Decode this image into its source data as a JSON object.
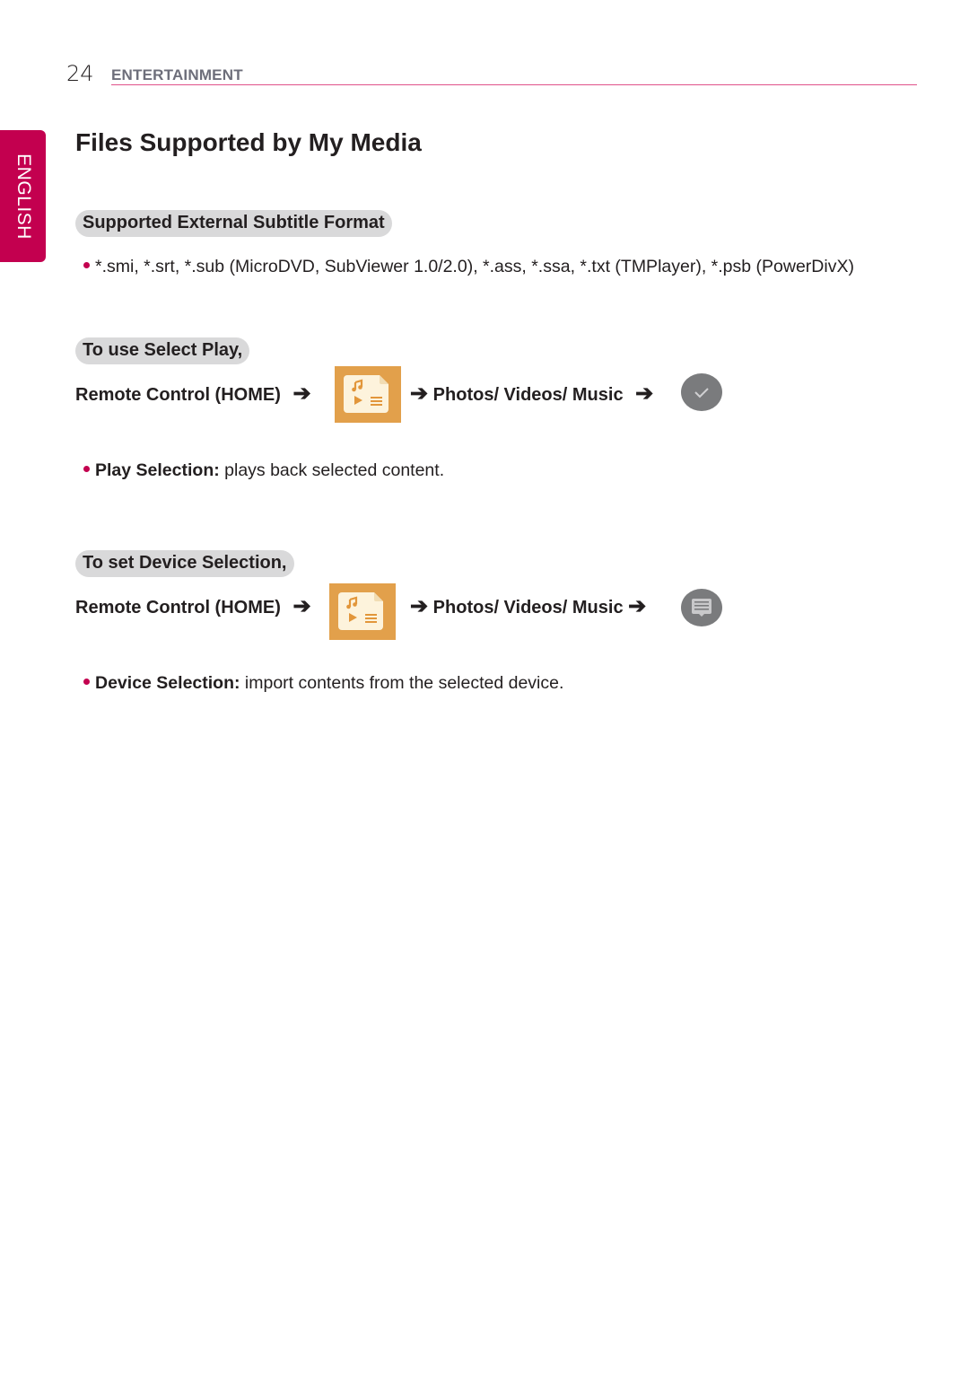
{
  "header": {
    "page_number": "24",
    "section": "ENTERTAINMENT",
    "accent_color": "#c3004f"
  },
  "language_tab": {
    "label": "ENGLISH"
  },
  "title": "Files Supported by My Media",
  "subtitle_section": {
    "heading": "Supported External Subtitle Format",
    "bullet": "*.smi, *.srt, *.sub (MicroDVD, SubViewer 1.0/2.0), *.ass, *.ssa, *.txt (TMPlayer), *.psb (PowerDivX)"
  },
  "select_play": {
    "heading": "To use Select Play,",
    "step1": "Remote Control (HOME)",
    "arrow": "➔",
    "app_icon": "my-media-icon",
    "step2": "Photos/ Videos/ Music",
    "final_icon": "checkmark-icon",
    "bullet_term": "Play Selection:",
    "bullet_desc": " plays back selected content."
  },
  "device_selection": {
    "heading": "To set Device Selection,",
    "step1": "Remote Control (HOME)",
    "arrow": "➔",
    "app_icon": "my-media-icon",
    "step2": "Photos/ Videos/ Music",
    "final_icon": "device-list-icon",
    "bullet_term": "Device Selection:",
    "bullet_desc": " import contents from the selected device."
  }
}
